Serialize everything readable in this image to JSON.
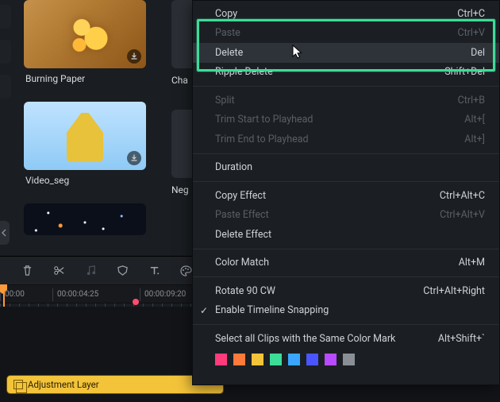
{
  "media": {
    "tiles": [
      {
        "label": "Burning Paper"
      },
      {
        "label": "Cha"
      },
      {
        "label": "Video_seg"
      },
      {
        "label": "Neg"
      }
    ]
  },
  "ruler": {
    "marks": [
      "00:00",
      "00:00:04:25",
      "00:00:09:20"
    ]
  },
  "clip": {
    "label": "Adjustment Layer"
  },
  "menu": {
    "copy": "Copy",
    "copy_sc": "Ctrl+C",
    "paste": "Paste",
    "paste_sc": "Ctrl+V",
    "delete": "Delete",
    "delete_sc": "Del",
    "ripple_delete": "Ripple Delete",
    "ripple_delete_sc": "Shift+Del",
    "split": "Split",
    "split_sc": "Ctrl+B",
    "trim_start": "Trim Start to Playhead",
    "trim_start_sc": "Alt+[",
    "trim_end": "Trim End to Playhead",
    "trim_end_sc": "Alt+]",
    "duration": "Duration",
    "copy_effect": "Copy Effect",
    "copy_effect_sc": "Ctrl+Alt+C",
    "paste_effect": "Paste Effect",
    "paste_effect_sc": "Ctrl+Alt+V",
    "delete_effect": "Delete Effect",
    "color_match": "Color Match",
    "color_match_sc": "Alt+M",
    "rotate": "Rotate 90 CW",
    "rotate_sc": "Ctrl+Alt+Right",
    "snapping": "Enable Timeline Snapping",
    "select_color": "Select all Clips with the Same Color Mark",
    "select_color_sc": "Alt+Shift+`"
  },
  "swatches": [
    "#ff3b7b",
    "#ff7a3a",
    "#f3c33a",
    "#3ddc97",
    "#3aa6ff",
    "#4a55ff",
    "#b84aff",
    "#8a8f96"
  ]
}
